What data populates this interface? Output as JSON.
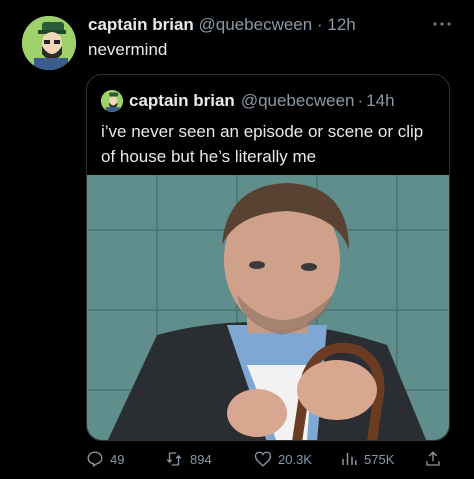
{
  "tweet": {
    "author_name": "captain brian",
    "handle": "@quebecween",
    "separator": "·",
    "time": "12h",
    "text": "nevermind",
    "more_icon": "more-dots-icon"
  },
  "quote": {
    "author_name": "captain brian",
    "handle": "@quebecween",
    "separator": "·",
    "time": "14h",
    "text": "i’ve never seen an episode or scene or clip of house but he’s literally me",
    "image_subject": "man in dark blazer holding a cane against a teal tiled wall"
  },
  "actions": {
    "replies": "49",
    "retweets": "894",
    "likes": "20.3K",
    "views": "575K",
    "icons": [
      "reply-icon",
      "retweet-icon",
      "like-icon",
      "views-icon",
      "share-icon"
    ]
  },
  "colors": {
    "background": "#000000",
    "primary_text": "#e7e9ea",
    "secondary_text": "#8b98a5",
    "border": "#2f3336",
    "avatar_bg": "#9fd16a"
  }
}
